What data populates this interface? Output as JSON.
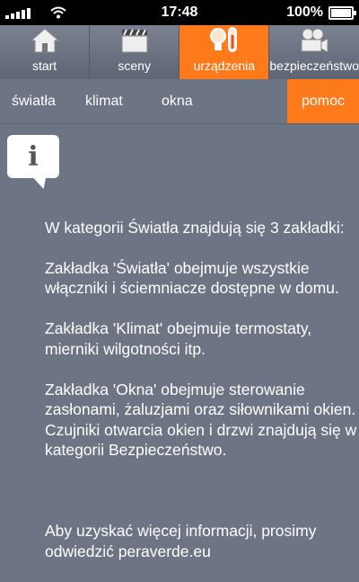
{
  "status": {
    "time": "17:48",
    "battery": "100%"
  },
  "main_tabs": [
    {
      "label": "start",
      "icon": "home-icon"
    },
    {
      "label": "sceny",
      "icon": "clapperboard-icon"
    },
    {
      "label": "urządzenia",
      "icon": "bulb-thermometer-icon",
      "active": true
    },
    {
      "label": "bezpieczeństwo",
      "icon": "camera-icon"
    }
  ],
  "sub_tabs": [
    {
      "label": "światła"
    },
    {
      "label": "klimat"
    },
    {
      "label": "okna"
    },
    {
      "label": "pomoc",
      "active": true
    }
  ],
  "help": {
    "lines": [
      "W kategorii Światła znajdują się 3 zakładki:",
      "Zakładka 'Światła' obejmuje wszystkie włączniki i ściemniacze dostępne w domu.",
      "Zakładka 'Klimat' obejmuje termostaty, mierniki wilgotności itp.",
      "Zakładka 'Okna' obejmuje sterowanie zasłonami, żaluzjami oraz siłownikami okien. Czujniki otwarcia okien i drzwi znajdują się w kategorii Bezpieczeństwo.",
      "",
      "Aby uzyskać więcej informacji, prosimy odwiedzić peraverde.eu"
    ]
  },
  "colors": {
    "accent": "#ff7a1a",
    "background": "#6d7483"
  }
}
